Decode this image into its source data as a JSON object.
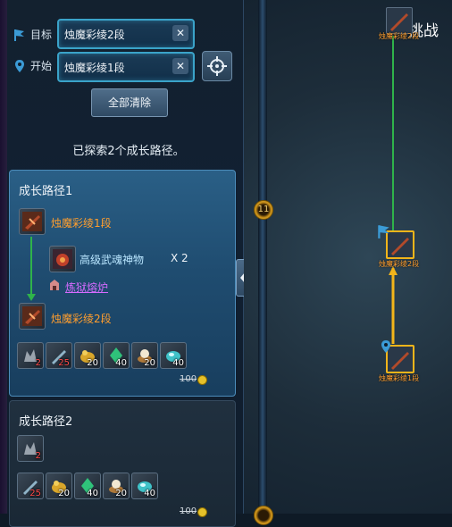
{
  "search": {
    "target_label": "目标",
    "target_value": "烛魔彩绫2段",
    "start_label": "开始",
    "start_value": "烛魔彩绫1段",
    "clear_symbol": "✕",
    "clear_all_label": "全部清除"
  },
  "status_text": "已探索2个成长路径。",
  "path1": {
    "title": "成长路径1",
    "from_item": "烛魔彩绫1段",
    "material_name": "高级武魂神物",
    "material_qty": "X 2",
    "station_name": "炼狱熔炉",
    "to_item": "烛魔彩绫2段",
    "resources": [
      {
        "qty": "2",
        "icon": "dark-ore-icon",
        "color": "#ff4a4a"
      },
      {
        "qty": "25",
        "icon": "blade-shard-icon",
        "color": "#ff4a4a"
      },
      {
        "qty": "20",
        "icon": "gold-pouch-icon",
        "color": "#ffffff"
      },
      {
        "qty": "40",
        "icon": "jade-crystal-icon",
        "color": "#ffffff"
      },
      {
        "qty": "20",
        "icon": "pearl-bowl-icon",
        "color": "#ffffff"
      },
      {
        "qty": "40",
        "icon": "teal-gem-icon",
        "color": "#ffffff"
      }
    ],
    "cost": "100"
  },
  "path2": {
    "title": "成长路径2",
    "top_slot_qty": "2",
    "resources": [
      {
        "qty": "25",
        "icon": "blade-shard-icon",
        "color": "#ff4a4a"
      },
      {
        "qty": "20",
        "icon": "gold-pouch-icon",
        "color": "#ffffff"
      },
      {
        "qty": "40",
        "icon": "jade-crystal-icon",
        "color": "#ffffff"
      },
      {
        "qty": "20",
        "icon": "pearl-bowl-icon",
        "color": "#ffffff"
      },
      {
        "qty": "40",
        "icon": "teal-gem-icon",
        "color": "#ffffff"
      }
    ],
    "cost": "100"
  },
  "map": {
    "challenge_label": "挑战",
    "rail_node_label": "11",
    "node_top_label": "烛魔彩绫2段",
    "node_mid_label": "烛魔彩绫2段",
    "node_bottom_label": "烛魔彩绫1段"
  },
  "colors": {
    "accent": "#3aa3c9",
    "item_orange": "#ff9e2e",
    "station_purple": "#d66bff",
    "path_green": "#2fb34a",
    "path_gold": "#f3b51a"
  }
}
